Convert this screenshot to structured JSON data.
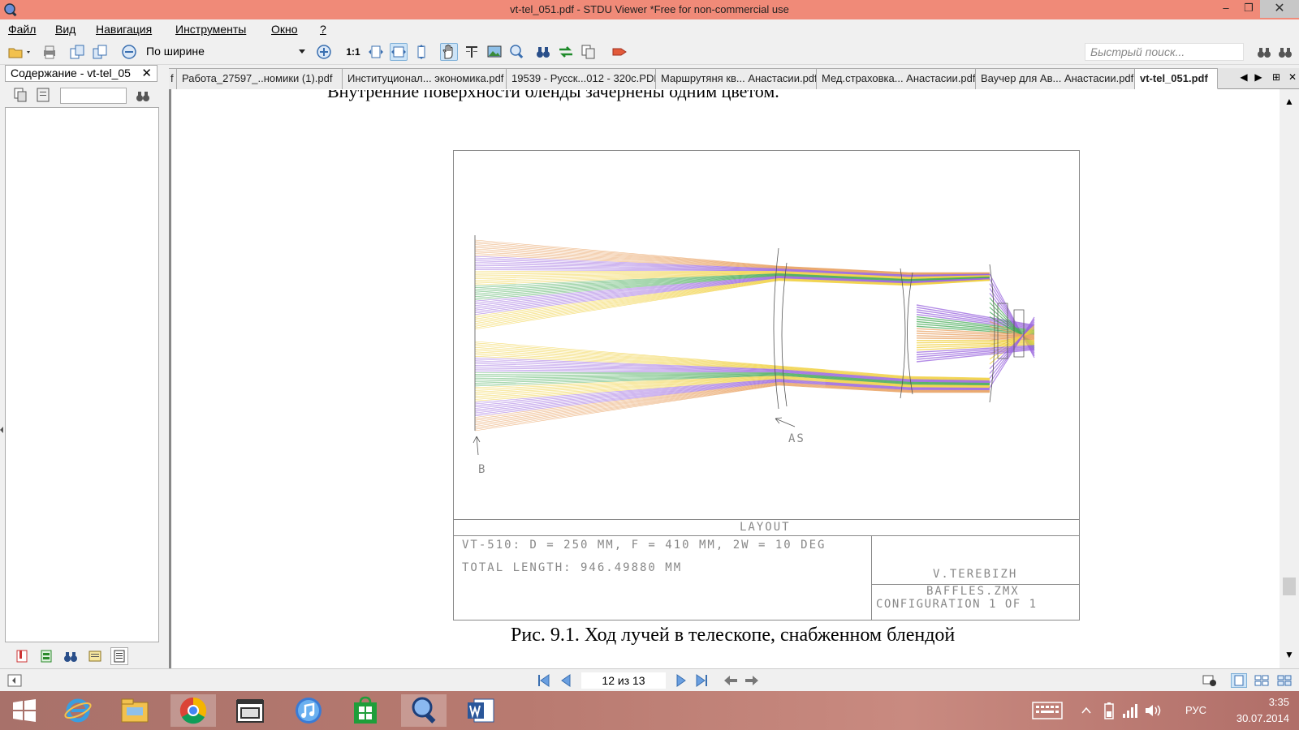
{
  "window": {
    "title": "vt-tel_051.pdf - STDU Viewer *Free for non-commercial use"
  },
  "menu": [
    "Файл",
    "Вид",
    "Навигация",
    "Инструменты",
    "Окно",
    "?"
  ],
  "toolbar": {
    "actual_size_label": "1:1",
    "zoom_mode": "По ширине",
    "search_placeholder": "Быстрый поиск..."
  },
  "left_panel": {
    "tab_label": "Содержание - vt-tel_05"
  },
  "tabs": [
    {
      "label": "f",
      "active": false
    },
    {
      "label": "Работа_27597_..номики (1).pdf",
      "active": false
    },
    {
      "label": "Институционал... экономика.pdf",
      "active": false
    },
    {
      "label": "19539 - Русск...012 - 320с.PDF",
      "active": false
    },
    {
      "label": "Маршрутяня кв... Анастасии.pdf",
      "active": false
    },
    {
      "label": "Мед.страховка... Анастасии.pdf",
      "active": false
    },
    {
      "label": "Ваучер для Ав... Анастасии.pdf",
      "active": false
    },
    {
      "label": "vt-tel_051.pdf",
      "active": true
    }
  ],
  "document": {
    "top_text": "Внутренние поверхности бленды зачернены одним цветом.",
    "figure": {
      "label_b": "B",
      "label_as": "AS",
      "layout_title": "LAYOUT",
      "spec_line1": "VT-510: D = 250 MM, F = 410 MM, 2W = 10 DEG",
      "spec_line2": "TOTAL LENGTH:  946.49880 MM",
      "author": "V.TEREBIZH",
      "file": "BAFFLES.ZMX",
      "config": "CONFIGURATION 1 OF 1"
    },
    "caption": "Рис. 9.1. Ход лучей в телескопе, снабженном блендой"
  },
  "navigation": {
    "page_indicator": "12 из 13"
  },
  "tray": {
    "language": "РУС",
    "time": "3:35",
    "date": "30.07.2014"
  },
  "colors": {
    "title_bar": "#f08a78",
    "ray_orange": "#e8a060",
    "ray_purple": "#9966dd",
    "ray_green": "#44aa55",
    "ray_yellow": "#f0d040",
    "ray_blue": "#7090e0"
  }
}
